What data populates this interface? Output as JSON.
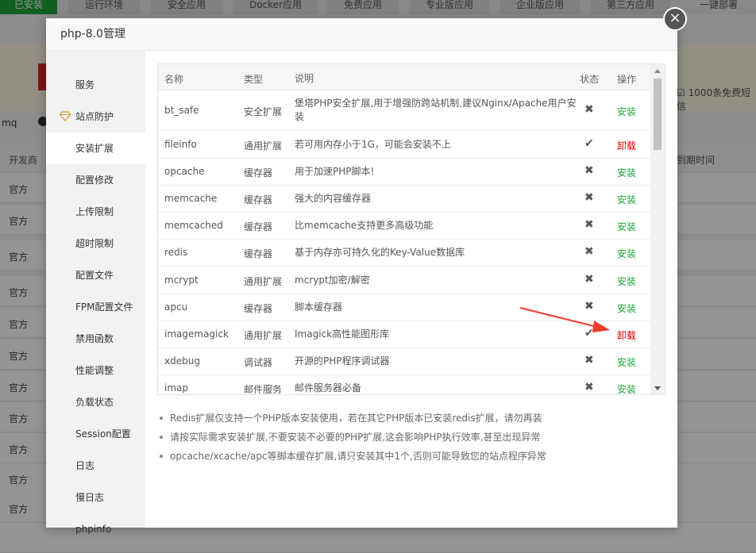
{
  "background": {
    "nav": [
      "已安装",
      "运行环境",
      "安全应用",
      "Docker应用",
      "免费应用",
      "专业版应用",
      "企业版应用",
      "第三方应用",
      "一键部署"
    ],
    "promo": "1000条免费短信",
    "mq": "mq",
    "table_headers": {
      "vendor": "开发商",
      "expire": "到期时间"
    },
    "row_vendor": "官方"
  },
  "modal": {
    "title": "php-8.0管理",
    "close_label": "×",
    "sidebar": [
      "服务",
      "站点防护",
      "安装扩展",
      "配置修改",
      "上传限制",
      "超时限制",
      "配置文件",
      "FPM配置文件",
      "禁用函数",
      "性能调整",
      "负载状态",
      "Session配置",
      "日志",
      "慢日志",
      "phpinfo"
    ],
    "headers": {
      "name": "名称",
      "type": "类型",
      "desc": "说明",
      "status": "状态",
      "op": "操作"
    },
    "extensions": [
      {
        "name": "bt_safe",
        "type": "安全扩展",
        "desc": "堡塔PHP安全扩展,用于增强防跨站机制,建议Nginx/Apache用户安装",
        "status": "✖",
        "op": "安装"
      },
      {
        "name": "fileinfo",
        "type": "通用扩展",
        "desc": "若可用内存小于1G，可能会安装不上",
        "status": "✔",
        "op": "卸载"
      },
      {
        "name": "opcache",
        "type": "缓存器",
        "desc": "用于加速PHP脚本!",
        "status": "✖",
        "op": "安装"
      },
      {
        "name": "memcache",
        "type": "缓存器",
        "desc": "强大的内容缓存器",
        "status": "✖",
        "op": "安装"
      },
      {
        "name": "memcached",
        "type": "缓存器",
        "desc": "比memcache支持更多高级功能",
        "status": "✖",
        "op": "安装"
      },
      {
        "name": "redis",
        "type": "缓存器",
        "desc": "基于内存亦可持久化的Key-Value数据库",
        "status": "✖",
        "op": "安装"
      },
      {
        "name": "mcrypt",
        "type": "通用扩展",
        "desc": "mcrypt加密/解密",
        "status": "✖",
        "op": "安装"
      },
      {
        "name": "apcu",
        "type": "缓存器",
        "desc": "脚本缓存器",
        "status": "✖",
        "op": "安装"
      },
      {
        "name": "imagemagick",
        "type": "通用扩展",
        "desc": "Imagick高性能图形库",
        "status": "✔",
        "op": "卸载"
      },
      {
        "name": "xdebug",
        "type": "调试器",
        "desc": "开源的PHP程序调试器",
        "status": "✖",
        "op": "安装"
      },
      {
        "name": "imap",
        "type": "邮件服务",
        "desc": "邮件服务器必备",
        "status": "✖",
        "op": "安装"
      }
    ],
    "notes": [
      "Redis扩展仅支持一个PHP版本安装使用，若在其它PHP版本已安装redis扩展，请勿再装",
      "请按实际需求安装扩展,不要安装不必要的PHP扩展,这会影响PHP执行效率,甚至出现异常",
      "opcache/xcache/apc等脚本缓存扩展,请只安装其中1个,否则可能导致您的站点程序异常"
    ]
  },
  "colors": {
    "install": "#20a53a",
    "uninstall": "#e10000",
    "arrow": "#f03c2b"
  }
}
